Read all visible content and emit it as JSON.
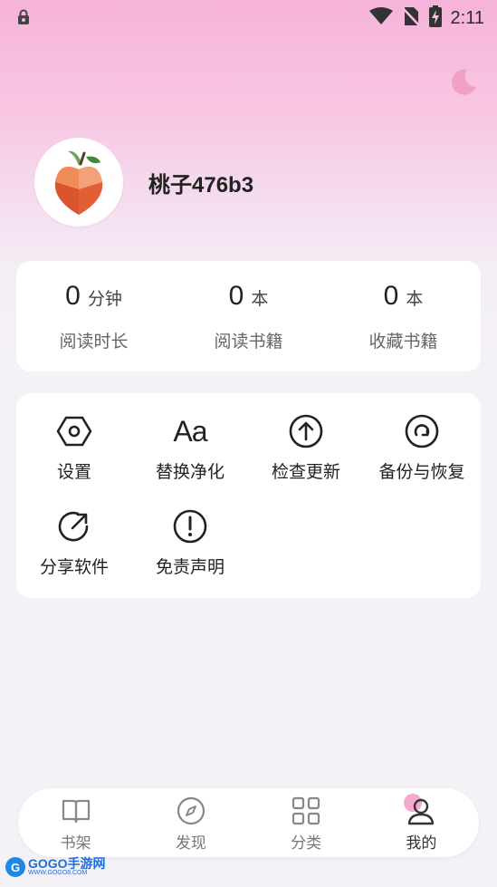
{
  "status_bar": {
    "time": "2:11"
  },
  "profile": {
    "username": "桃子476b3"
  },
  "stats": [
    {
      "value": "0",
      "unit": "分钟",
      "label": "阅读时长"
    },
    {
      "value": "0",
      "unit": "本",
      "label": "阅读书籍"
    },
    {
      "value": "0",
      "unit": "本",
      "label": "收藏书籍"
    }
  ],
  "menu": {
    "items": [
      {
        "label": "设置",
        "icon": "settings-hexagon-icon"
      },
      {
        "label": "替换净化",
        "icon": "text-replace-icon"
      },
      {
        "label": "检查更新",
        "icon": "arrow-up-circle-icon"
      },
      {
        "label": "备份与恢复",
        "icon": "backup-restore-icon"
      },
      {
        "label": "分享软件",
        "icon": "share-icon"
      },
      {
        "label": "免责声明",
        "icon": "exclamation-circle-icon"
      }
    ],
    "replace_icon_text": "Aa"
  },
  "tabbar": {
    "items": [
      {
        "label": "书架",
        "icon": "book-icon",
        "active": false
      },
      {
        "label": "发现",
        "icon": "compass-icon",
        "active": false
      },
      {
        "label": "分类",
        "icon": "grid-icon",
        "active": false
      },
      {
        "label": "我的",
        "icon": "user-icon",
        "active": true
      }
    ]
  },
  "watermark": {
    "logo": "G",
    "main": "GOGO手游网",
    "sub": "WWW.GOGO8.COM"
  },
  "colors": {
    "accent_pink": "#f3a8cf",
    "moon": "#f2a1c2",
    "peach": "#e8643e"
  }
}
